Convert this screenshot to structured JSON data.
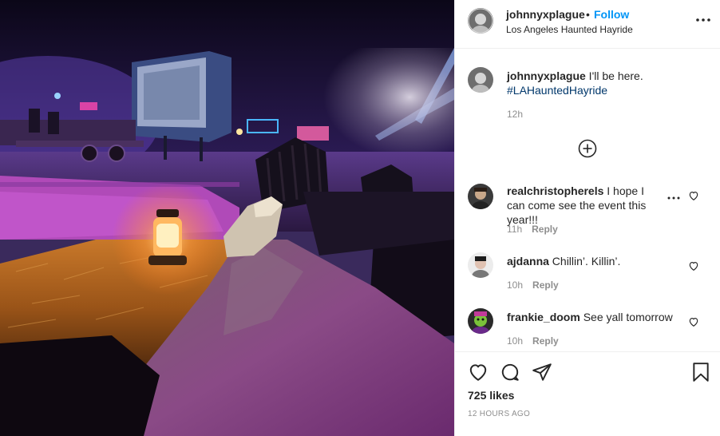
{
  "post": {
    "author": "johnnyxplague",
    "dot": "•",
    "follow_label": "Follow",
    "location": "Los Angeles Haunted Hayride"
  },
  "caption": {
    "username": "johnnyxplague",
    "text": " I'll be here.",
    "hashtag": "#LAHauntedHayride",
    "time": "12h"
  },
  "comments": [
    {
      "username": "realchristopherels",
      "text": " I hope I can come see the event this year!!!",
      "time": "11h",
      "reply_label": "Reply"
    },
    {
      "username": "ajdanna",
      "text": " Chillin’. Killin’.",
      "time": "10h",
      "reply_label": "Reply"
    },
    {
      "username": "frankie_doom",
      "text": " See yall tomorrow",
      "time": "10h",
      "reply_label": "Reply"
    }
  ],
  "footer": {
    "likes": "725 likes",
    "posted": "12 HOURS AGO"
  },
  "icons": {
    "more": "more-options-icon",
    "load_more": "plus-circle-icon",
    "like": "heart-icon",
    "comment": "comment-icon",
    "share": "share-icon",
    "save": "bookmark-icon"
  },
  "colors": {
    "follow": "#0095f6",
    "hashtag": "#00376b",
    "meta": "#8e8e8e",
    "divider": "#efefef"
  }
}
